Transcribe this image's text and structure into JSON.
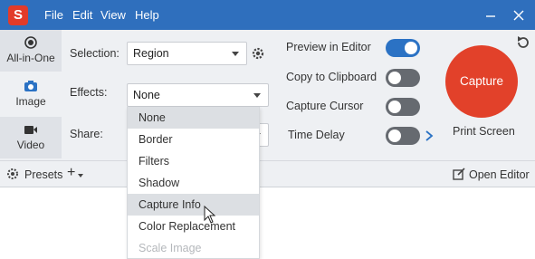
{
  "titlebar": {
    "logo": "S",
    "menu": [
      "File",
      "Edit",
      "View",
      "Help"
    ],
    "minimize_icon": "minimize-icon",
    "close_icon": "close-icon"
  },
  "nav": {
    "tabs": [
      {
        "label": "All-in-One",
        "icon": "all-in-one-icon"
      },
      {
        "label": "Image",
        "icon": "camera-icon"
      },
      {
        "label": "Video",
        "icon": "video-camera-icon"
      }
    ]
  },
  "settings": {
    "selection_label": "Selection:",
    "selection_value": "Region",
    "effects_label": "Effects:",
    "effects_value": "None",
    "share_label": "Share:"
  },
  "options": {
    "preview_in_editor": {
      "label": "Preview in Editor",
      "on": true
    },
    "copy_to_clipboard": {
      "label": "Copy to Clipboard",
      "on": false
    },
    "capture_cursor": {
      "label": "Capture Cursor",
      "on": false
    },
    "time_delay": {
      "label": "Time Delay",
      "on": false
    }
  },
  "capture": {
    "button_label": "Capture",
    "sublabel": "Print Screen"
  },
  "bottombar": {
    "presets_label": "Presets",
    "add_label": "+",
    "open_editor_label": "Open Editor"
  },
  "effects_list": {
    "items": [
      "None",
      "Border",
      "Filters",
      "Shadow",
      "Capture Info",
      "Color Replacement",
      "Scale Image"
    ],
    "selected": "None",
    "hovered": "Capture Info"
  },
  "colors": {
    "titlebar": "#2f6fbd",
    "capture": "#e2412a",
    "toggle_on": "#2b72c4",
    "toggle_off": "#666a70"
  }
}
